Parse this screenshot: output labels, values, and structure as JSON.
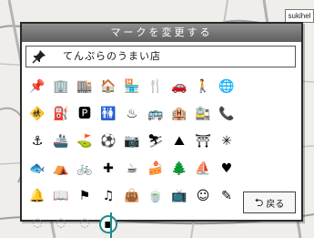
{
  "dialog": {
    "title": "マークを変更する",
    "name_icon": "pushpin-icon",
    "name_text": "てんぷらのうまい店"
  },
  "marks": [
    {
      "name": "pushpin-mark",
      "glyph": "📌"
    },
    {
      "name": "building-mark",
      "glyph": "🏢"
    },
    {
      "name": "tall-building-mark",
      "glyph": "🏬"
    },
    {
      "name": "house-mark",
      "glyph": "🏠"
    },
    {
      "name": "shop-mark",
      "glyph": "🏪"
    },
    {
      "name": "restaurant-mark",
      "glyph": "🍴"
    },
    {
      "name": "car-mark",
      "glyph": "🚗"
    },
    {
      "name": "person-mark",
      "glyph": "🚶"
    },
    {
      "name": "globe-mark",
      "glyph": "🌐"
    },
    {
      "name": "sign-mark",
      "glyph": "🚸"
    },
    {
      "name": "gas-station-mark",
      "glyph": "⛽"
    },
    {
      "name": "parking-mark",
      "glyph": "🅿"
    },
    {
      "name": "toilet-mark",
      "glyph": "🚻"
    },
    {
      "name": "hot-spring-mark",
      "glyph": "♨"
    },
    {
      "name": "bus-mark",
      "glyph": "🚌"
    },
    {
      "name": "hotel-mark",
      "glyph": "🏨"
    },
    {
      "name": "station-mark",
      "glyph": "🚉"
    },
    {
      "name": "phone-mark",
      "glyph": "📞"
    },
    {
      "name": "anchor-mark",
      "glyph": "⚓"
    },
    {
      "name": "ship-mark",
      "glyph": "🚢"
    },
    {
      "name": "golf-mark",
      "glyph": "⛳"
    },
    {
      "name": "ball-mark",
      "glyph": "⚽"
    },
    {
      "name": "camera-mark",
      "glyph": "📷"
    },
    {
      "name": "ski-mark",
      "glyph": "⛷"
    },
    {
      "name": "mountain-mark",
      "glyph": "⛰"
    },
    {
      "name": "temple-mark",
      "glyph": "⛩"
    },
    {
      "name": "star-mark",
      "glyph": "✳"
    },
    {
      "name": "fish-mark",
      "glyph": "🐟"
    },
    {
      "name": "tent-mark",
      "glyph": "⛺"
    },
    {
      "name": "bicycle-mark",
      "glyph": "🚲"
    },
    {
      "name": "cross-mark",
      "glyph": "✚"
    },
    {
      "name": "coffee-mark",
      "glyph": "☕"
    },
    {
      "name": "cake-mark",
      "glyph": "🍰"
    },
    {
      "name": "tree-mark",
      "glyph": "🌲"
    },
    {
      "name": "boat-mark",
      "glyph": "⛵"
    },
    {
      "name": "heart-mark",
      "glyph": "♥"
    },
    {
      "name": "bell-mark",
      "glyph": "🔔"
    },
    {
      "name": "book-mark",
      "glyph": "📖"
    },
    {
      "name": "flag-mark",
      "glyph": "⚑"
    },
    {
      "name": "music-mark",
      "glyph": "♫"
    },
    {
      "name": "bag-mark",
      "glyph": "👜"
    },
    {
      "name": "cup-mark",
      "glyph": "🍵"
    },
    {
      "name": "tv-mark",
      "glyph": "📺"
    },
    {
      "name": "face-mark",
      "glyph": "☺"
    },
    {
      "name": "pencil-mark",
      "glyph": "✎"
    },
    {
      "name": "empty-mark-1",
      "glyph": "◌",
      "light": true
    },
    {
      "name": "empty-mark-2",
      "glyph": "◌",
      "light": true
    },
    {
      "name": "empty-mark-3",
      "glyph": "◌",
      "light": true
    },
    {
      "name": "selected-mark",
      "glyph": "▪",
      "selected": true
    }
  ],
  "back_button": {
    "label": "戻る",
    "icon": "return-arrow-icon",
    "glyph": "⮌"
  },
  "map_tag": "sukihel"
}
